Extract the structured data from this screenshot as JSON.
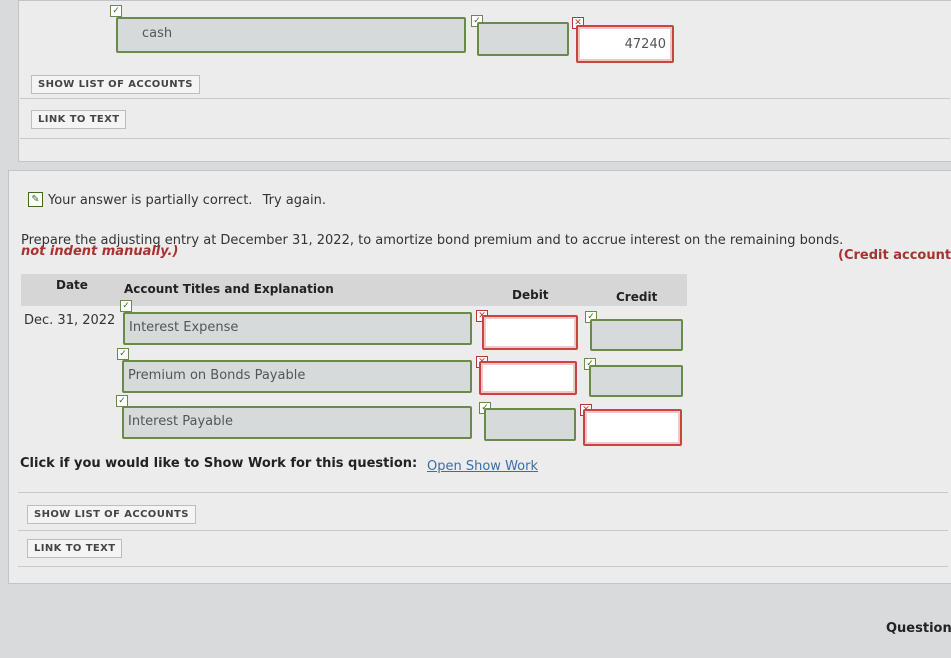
{
  "top_entry": {
    "account_title": "cash",
    "debit": "",
    "credit": "47240"
  },
  "top_buttons": {
    "show_list": "SHOW LIST OF ACCOUNTS",
    "link_text": "LINK TO TEXT"
  },
  "feedback": {
    "status": "Your answer is partially correct.",
    "try_again": "Try again."
  },
  "instructions": {
    "text": "Prepare the adjusting entry at December 31, 2022, to amortize bond premium and to accrue interest on the remaining bonds.",
    "note_line1": "(Credit account t",
    "note_line2": "not indent manually.)"
  },
  "table": {
    "headers": {
      "date": "Date",
      "account": "Account Titles and Explanation",
      "debit": "Debit",
      "credit": "Credit"
    },
    "rows": [
      {
        "date": "Dec. 31, 2022",
        "account": "Interest Expense",
        "debit": "",
        "credit": ""
      },
      {
        "date": "",
        "account": "Premium on Bonds Payable",
        "debit": "",
        "credit": ""
      },
      {
        "date": "",
        "account": "Interest Payable",
        "debit": "",
        "credit": ""
      }
    ]
  },
  "show_work": {
    "prompt": "Click if you would like to Show Work for this question:",
    "link": "Open Show Work"
  },
  "bottom_buttons": {
    "show_list": "SHOW LIST OF ACCOUNTS",
    "link_text": "LINK TO TEXT"
  },
  "footer": {
    "question": "Question"
  }
}
